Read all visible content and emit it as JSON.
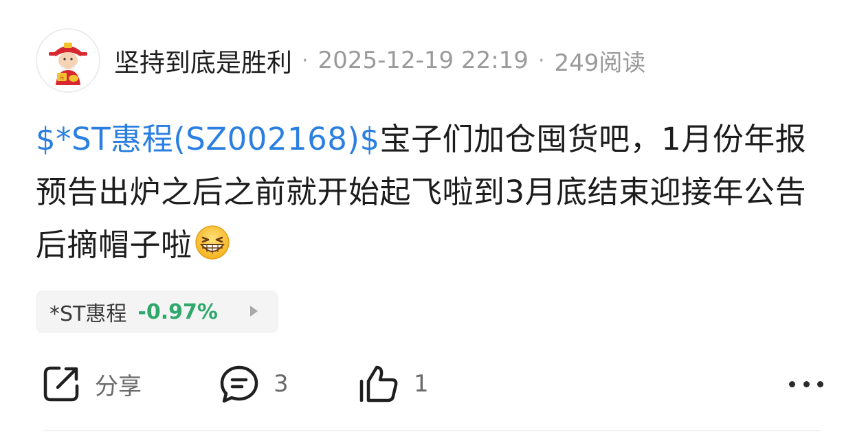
{
  "header": {
    "username": "坚持到底是胜利",
    "separator": "·",
    "datetime": "2025-12-19 22:19",
    "views": "249阅读"
  },
  "post": {
    "stock_link": "$*ST惠程(SZ002168)$",
    "text": "宝子们加仓囤货吧，1月份年报预告出炉之后之前就开始起飞啦到3月底结束迎接年公告后摘帽子啦",
    "emoji": "grinning-squint-emoji"
  },
  "stock_chip": {
    "name": "*ST惠程",
    "change": "-0.97%",
    "change_color": "#2ea86b",
    "arrow_icon": "triangle-right-icon"
  },
  "actions": {
    "share_label": "分享",
    "comment_count": "3",
    "like_count": "1",
    "share_icon": "share-icon",
    "comment_icon": "comment-icon",
    "like_icon": "thumbs-up-icon",
    "more_icon": "more-icon"
  },
  "colors": {
    "link": "#2b7fe0",
    "text": "#1c1c1c",
    "muted": "#9a9a9a"
  }
}
